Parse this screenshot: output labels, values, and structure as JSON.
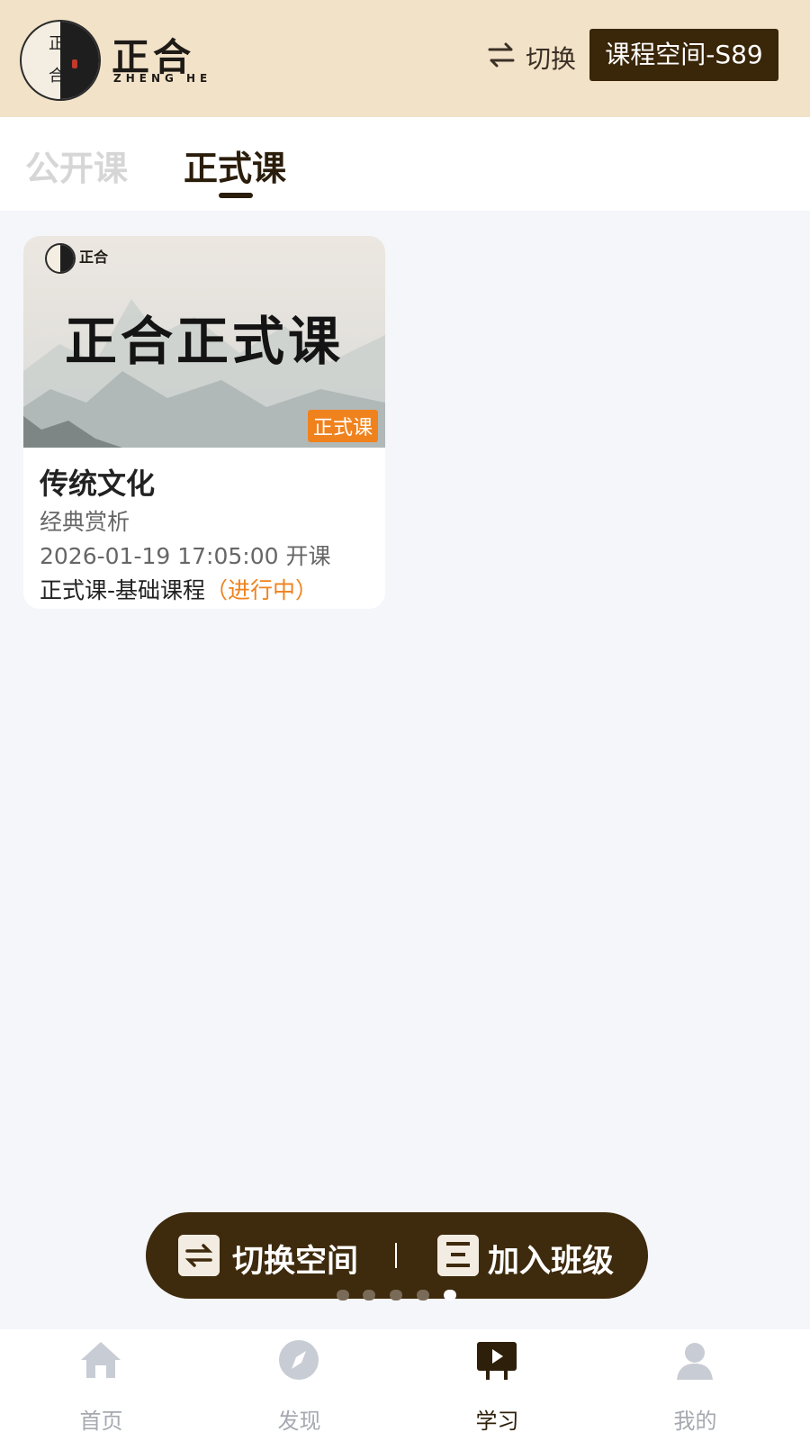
{
  "header": {
    "logo_chars": [
      "正",
      "合"
    ],
    "brand_cn": "正合",
    "brand_en": "ZHENG HE",
    "switch_label": "切换",
    "space_button": "课程空间-S89"
  },
  "tabs": [
    {
      "label": "公开课",
      "active": false
    },
    {
      "label": "正式课",
      "active": true
    }
  ],
  "course_card": {
    "cover_brand": "正合",
    "cover_title": "正合正式课",
    "cover_tag": "正式课",
    "title": "传统文化",
    "subtitle": "经典赏析",
    "time": "2026-01-19 17:05:00 开课",
    "type": "正式课-基础课程",
    "status": "（进行中）"
  },
  "floating_bar": {
    "switch_space_label": "切换空间",
    "join_class_label": "加入班级",
    "page_dots_count": 5,
    "active_dot_index": 4
  },
  "bottom_nav": {
    "items": [
      {
        "label": "首页",
        "icon": "home-icon",
        "active": false
      },
      {
        "label": "发现",
        "icon": "compass-icon",
        "active": false
      },
      {
        "label": "学习",
        "icon": "study-play-icon",
        "active": true
      },
      {
        "label": "我的",
        "icon": "profile-icon",
        "active": false
      }
    ]
  },
  "colors": {
    "header_bg": "#f2e2c8",
    "primary_dark": "#3a2608",
    "accent_orange": "#f0821e",
    "page_bg": "#f4f6fa"
  }
}
